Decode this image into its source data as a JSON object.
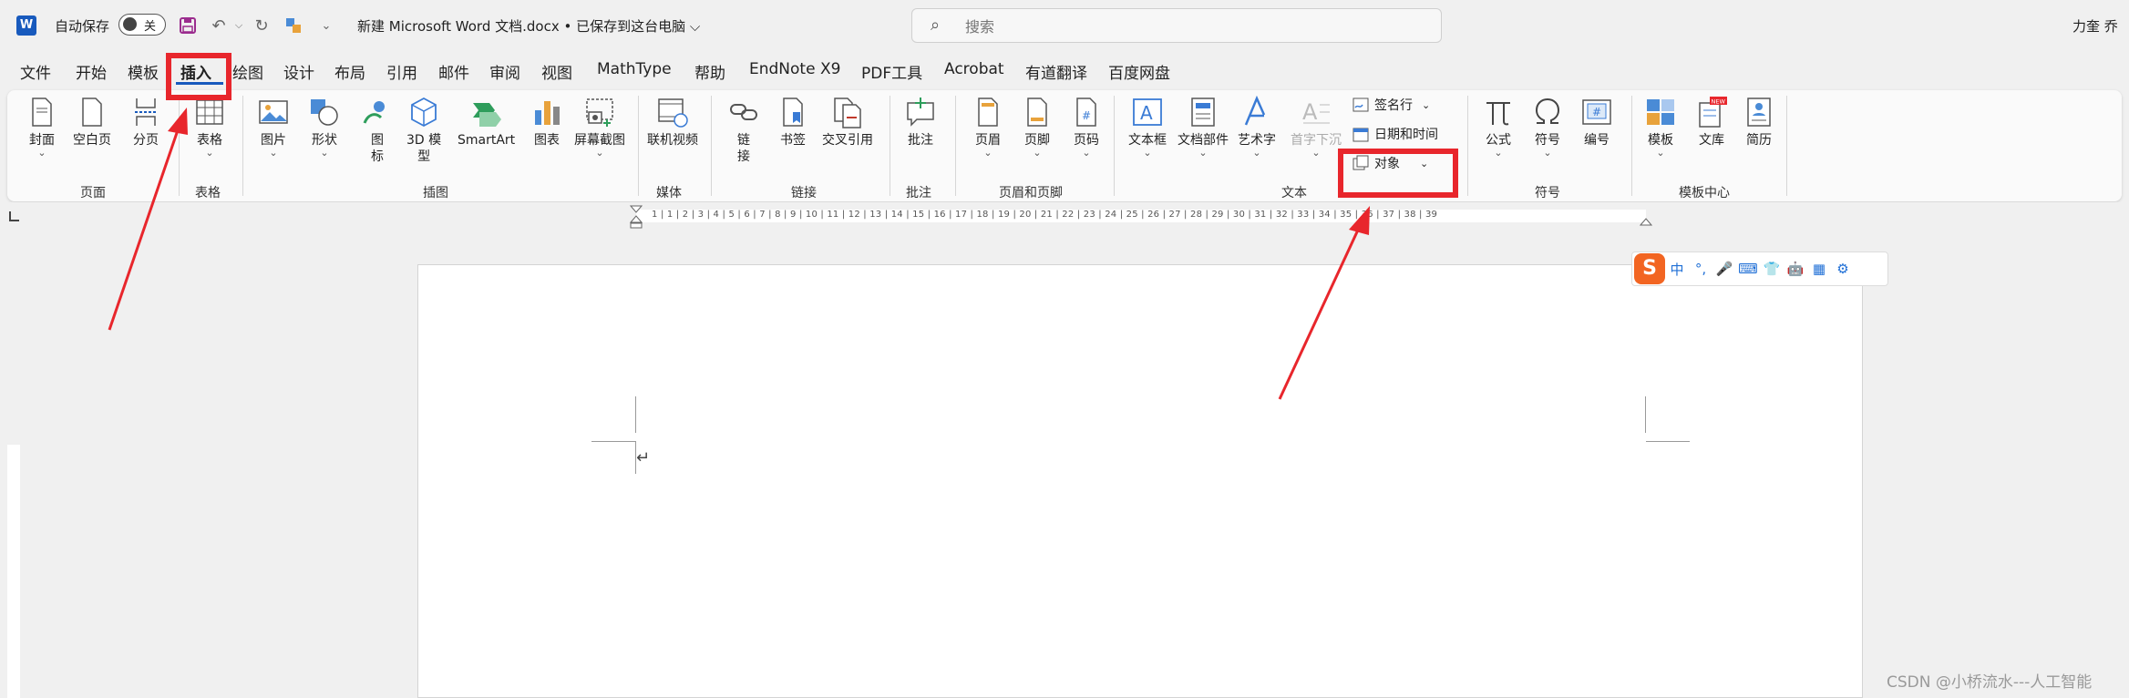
{
  "titlebar": {
    "app_logo": "W",
    "autosave_label": "自动保存",
    "autosave_state": "关",
    "doc_title": "新建 Microsoft Word 文档.docx • 已保存到这台电脑 ⌵",
    "search_placeholder": "搜索",
    "user_name": "力奎 乔"
  },
  "menu": {
    "tabs": [
      "文件",
      "开始",
      "模板",
      "插入",
      "绘图",
      "设计",
      "布局",
      "引用",
      "邮件",
      "审阅",
      "视图",
      "MathType",
      "帮助",
      "EndNote X9",
      "PDF工具",
      "Acrobat",
      "有道翻译",
      "百度网盘"
    ]
  },
  "ribbon": {
    "buttons": {
      "cover": "封面",
      "blank_page": "空白页",
      "page_break": "分页",
      "table": "表格",
      "picture": "图片",
      "shapes": "形状",
      "icons": "图\n标",
      "model3d": "3D 模\n型",
      "smartart": "SmartArt",
      "chart": "图表",
      "screenshot": "屏幕截图",
      "online_video": "联机视频",
      "link": "链\n接",
      "bookmark": "书签",
      "cross_ref": "交叉引用",
      "comment": "批注",
      "header": "页眉",
      "footer": "页脚",
      "page_number": "页码",
      "textbox": "文本框",
      "doc_parts": "文档部件",
      "wordart": "艺术字",
      "dropcap": "首字下沉",
      "signature_line": "签名行",
      "date_time": "日期和时间",
      "object": "对象",
      "equation": "公式",
      "symbol": "符号",
      "numbering": "编号",
      "template": "模板",
      "library": "文库",
      "resume": "简历",
      "new_badge": "NEW"
    },
    "groups": {
      "pages": "页面",
      "tables": "表格",
      "illustrations": "插图",
      "media": "媒体",
      "links": "链接",
      "comments": "批注",
      "header_footer": "页眉和页脚",
      "text": "文本",
      "symbols": "符号",
      "template_center": "模板中心"
    }
  },
  "ruler": {
    "numbers": "1 | 1 | 2 | 3 | 4 | 5 | 6 | 7 | 8 | 9 | 10 | 11 | 12 | 13 | 14 | 15 | 16 | 17 | 18 | 19 | 20 | 21 | 22 | 23 | 24 | 25 | 26 | 27 | 28 | 29 | 30 | 31 | 32 | 33 | 34 | 35 | 36 | 37 | 38 | 39"
  },
  "ime": {
    "logo": "S",
    "lang": "中",
    "punct": "°,",
    "mic": "🎤",
    "keyboard": "⌨",
    "skin": "👕",
    "robot": "🤖",
    "apps": "▦",
    "settings": "⚙"
  },
  "watermark": "CSDN @小桥流水---人工智能",
  "colors": {
    "annotation_red": "#e8262c",
    "accent_blue": "#185abd"
  }
}
